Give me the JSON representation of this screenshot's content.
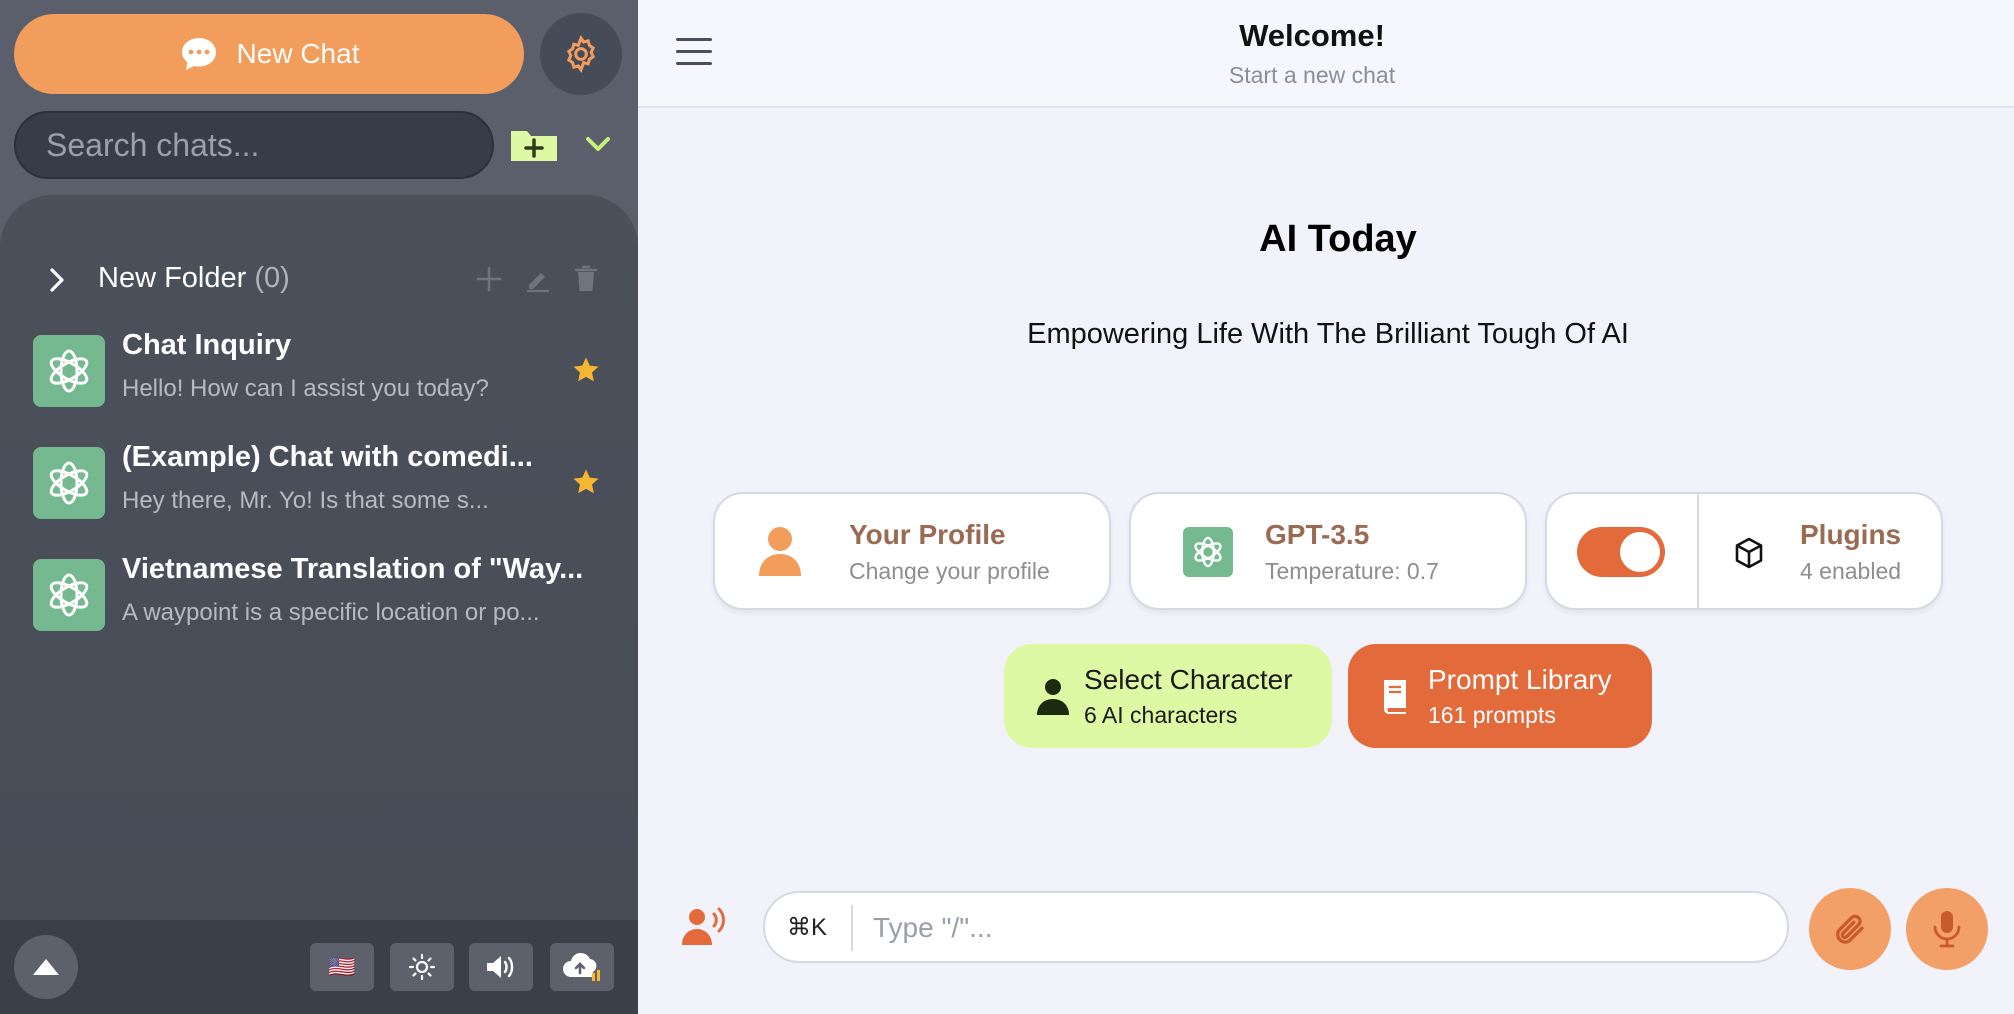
{
  "sidebar": {
    "new_chat_label": "New Chat",
    "search_placeholder": "Search chats...",
    "folder": {
      "name": "New Folder",
      "count": "(0)"
    },
    "chats": [
      {
        "title": "Chat Inquiry",
        "preview": "Hello! How can I assist you today?",
        "starred": true
      },
      {
        "title": "(Example) Chat with comedi...",
        "preview": "Hey there, Mr. Yo! Is that some s...",
        "starred": true
      },
      {
        "title": "Vietnamese Translation of \"Way...",
        "preview": "A waypoint is a specific location or po...",
        "starred": false
      }
    ],
    "footer": {
      "flag": "🇺🇸"
    }
  },
  "header": {
    "title": "Welcome!",
    "subtitle": "Start a new chat"
  },
  "hero": {
    "title": "AI Today",
    "subtitle": "Empowering Life With The Brilliant Tough Of AI"
  },
  "cards": {
    "profile": {
      "title": "Your Profile",
      "subtitle": "Change your profile"
    },
    "model": {
      "title": "GPT-3.5",
      "subtitle": "Temperature: 0.7"
    },
    "plugins": {
      "title": "Plugins",
      "subtitle": "4 enabled",
      "toggle_on": true
    }
  },
  "pills": {
    "character": {
      "title": "Select Character",
      "subtitle": "6 AI characters"
    },
    "prompts": {
      "title": "Prompt Library",
      "subtitle": "161 prompts"
    }
  },
  "composer": {
    "shortcut": "⌘K",
    "placeholder": "Type \"/\"..."
  },
  "colors": {
    "accent_orange": "#f39d5d",
    "deep_orange": "#e36a3a",
    "lime": "#ddf9a4",
    "sidebar": "#5a5f6b",
    "openai_green": "#74b98f"
  }
}
